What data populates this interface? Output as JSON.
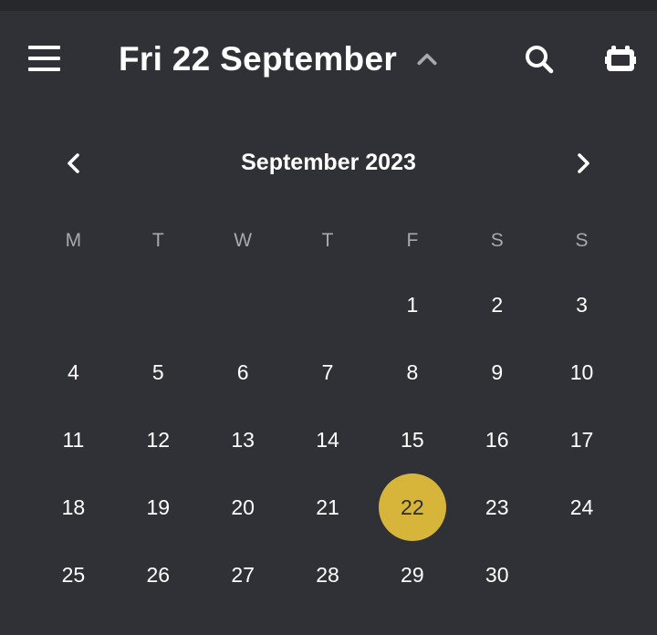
{
  "header": {
    "title": "Fri 22 September",
    "icons": {
      "menu": "menu-icon",
      "expand": "chevron-up-icon",
      "search": "search-icon",
      "today": "calendar-today-icon"
    }
  },
  "calendar": {
    "month_label": "September 2023",
    "prev_icon": "chevron-left-icon",
    "next_icon": "chevron-right-icon",
    "weekdays": [
      "M",
      "T",
      "W",
      "T",
      "F",
      "S",
      "S"
    ],
    "selected_day": "22",
    "accent_color": "#d6b53a",
    "weeks": [
      [
        "",
        "",
        "",
        "",
        "1",
        "2",
        "3"
      ],
      [
        "4",
        "5",
        "6",
        "7",
        "8",
        "9",
        "10"
      ],
      [
        "11",
        "12",
        "13",
        "14",
        "15",
        "16",
        "17"
      ],
      [
        "18",
        "19",
        "20",
        "21",
        "22",
        "23",
        "24"
      ],
      [
        "25",
        "26",
        "27",
        "28",
        "29",
        "30",
        ""
      ]
    ]
  }
}
